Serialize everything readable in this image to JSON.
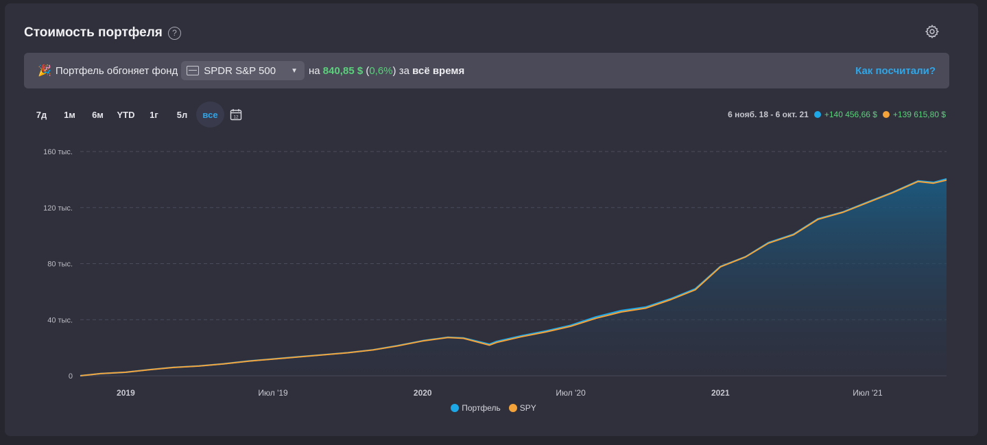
{
  "header": {
    "title": "Стоимость портфеля",
    "help": "?"
  },
  "banner": {
    "emoji": "🎉",
    "text_before": "Портфель обгоняет фонд",
    "fund_name": "SPDR S&P 500",
    "text_on": "на",
    "amount": "840,85 $",
    "paren_open": "(",
    "percent": "0,6%",
    "paren_close": ")",
    "text_for": "за",
    "period_text": "всё время",
    "link": "Как посчитали?"
  },
  "periods": [
    "7д",
    "1м",
    "6м",
    "YTD",
    "1г",
    "5л",
    "все"
  ],
  "active_period": "все",
  "calendar_label": "12",
  "summary": {
    "range": "6 нояб. 18 - 6 окт. 21",
    "portfolio_change": "+140 456,66 $",
    "spy_change": "+139 615,80 $"
  },
  "colors": {
    "portfolio": "#1ea7e6",
    "spy": "#f4a23a",
    "accent": "#2fa6e8",
    "positive": "#5ad17a"
  },
  "chart_data": {
    "type": "area",
    "xlabel": "",
    "ylabel": "",
    "ylim": [
      0,
      160000
    ],
    "y_ticks": [
      {
        "value": 0,
        "label": "0"
      },
      {
        "value": 40000,
        "label": "40 тыс."
      },
      {
        "value": 80000,
        "label": "80 тыс."
      },
      {
        "value": 120000,
        "label": "120 тыс."
      },
      {
        "value": 160000,
        "label": "160 тыс."
      }
    ],
    "x_range": [
      "2018-11-06",
      "2021-10-06"
    ],
    "x_ticks": [
      {
        "date": "2019-01-01",
        "label": "2019",
        "bold": true
      },
      {
        "date": "2019-07-01",
        "label": "Июл '19",
        "bold": false
      },
      {
        "date": "2020-01-01",
        "label": "2020",
        "bold": true
      },
      {
        "date": "2020-07-01",
        "label": "Июл '20",
        "bold": false
      },
      {
        "date": "2021-01-01",
        "label": "2021",
        "bold": true
      },
      {
        "date": "2021-07-01",
        "label": "Июл '21",
        "bold": false
      }
    ],
    "grid": true,
    "legend": "bottom-center",
    "x": [
      "2018-11-06",
      "2018-12-01",
      "2019-01-01",
      "2019-02-01",
      "2019-03-01",
      "2019-04-01",
      "2019-05-01",
      "2019-06-01",
      "2019-07-01",
      "2019-08-01",
      "2019-09-01",
      "2019-10-01",
      "2019-11-01",
      "2019-12-01",
      "2020-01-01",
      "2020-02-01",
      "2020-02-20",
      "2020-03-23",
      "2020-04-01",
      "2020-05-01",
      "2020-06-01",
      "2020-07-01",
      "2020-08-01",
      "2020-09-01",
      "2020-10-01",
      "2020-11-01",
      "2020-12-01",
      "2021-01-01",
      "2021-02-01",
      "2021-03-01",
      "2021-04-01",
      "2021-05-01",
      "2021-06-01",
      "2021-07-01",
      "2021-08-01",
      "2021-09-01",
      "2021-09-20",
      "2021-10-06"
    ],
    "series": [
      {
        "name": "Портфель",
        "values": [
          0,
          1500,
          2500,
          4500,
          6000,
          7000,
          8500,
          10500,
          12000,
          13500,
          15000,
          16500,
          18500,
          21500,
          25000,
          27500,
          27000,
          22500,
          24500,
          28500,
          32000,
          36000,
          42000,
          46500,
          49000,
          55000,
          62000,
          78000,
          85000,
          95000,
          101000,
          112000,
          117000,
          124000,
          131000,
          139000,
          138000,
          140457
        ]
      },
      {
        "name": "SPY",
        "values": [
          0,
          1500,
          2500,
          4400,
          5900,
          6900,
          8400,
          10400,
          11900,
          13400,
          14900,
          16400,
          18400,
          21300,
          24800,
          27300,
          26700,
          21800,
          23800,
          27800,
          31300,
          35300,
          41000,
          45500,
          48200,
          54300,
          61300,
          77700,
          84800,
          94600,
          100600,
          111600,
          116700,
          123600,
          130700,
          138600,
          137400,
          139616
        ]
      }
    ]
  },
  "legend": [
    "Портфель",
    "SPY"
  ]
}
